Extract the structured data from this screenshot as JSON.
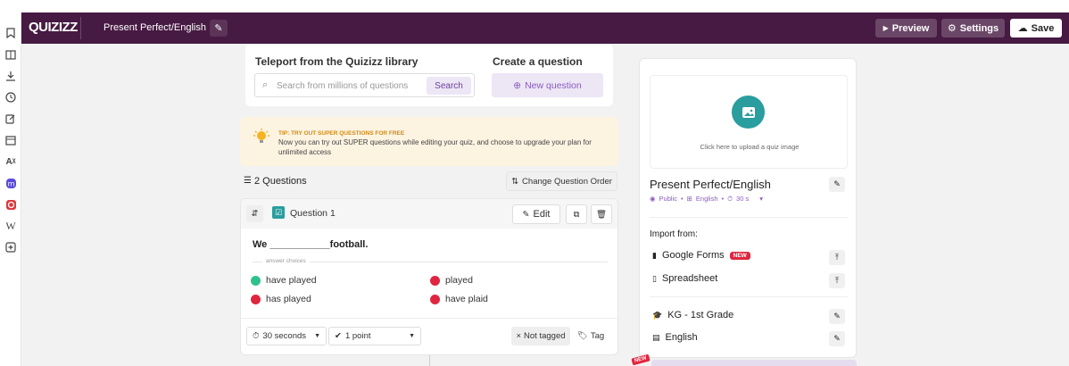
{
  "header": {
    "logo": "QUIZIZZ",
    "quiz_title": "Present Perfect/English",
    "preview_label": "Preview",
    "settings_label": "Settings",
    "save_label": "Save"
  },
  "sidebar": {
    "icons": [
      "bookmark-icon",
      "library-icon",
      "download-icon",
      "history-icon",
      "edit-icon",
      "calendar-icon",
      "translate-icon",
      "mastodon-icon",
      "vivaldi-icon",
      "wikipedia-icon",
      "add-box-icon"
    ]
  },
  "teleport": {
    "heading": "Teleport from the Quizizz library",
    "search_placeholder": "Search from millions of questions",
    "search_button": "Search"
  },
  "create": {
    "heading": "Create a question",
    "new_question_label": "New question"
  },
  "tip": {
    "title": "TIP: TRY OUT SUPER QUESTIONS FOR FREE",
    "body": "Now you can try out SUPER questions while editing your quiz, and choose to upgrade your plan for unlimited access"
  },
  "questions": {
    "count_label": "2 Questions",
    "change_order_label": "Change Question Order"
  },
  "question1": {
    "label": "Question 1",
    "edit_label": "Edit",
    "text": "We ___________football.",
    "answer_choices_label": "answer choices",
    "choices": [
      {
        "text": "have played",
        "correct": true
      },
      {
        "text": "played",
        "correct": false
      },
      {
        "text": "has played",
        "correct": false
      },
      {
        "text": "have plaid",
        "correct": false
      }
    ],
    "time_label": "30 seconds",
    "points_label": "1 point",
    "not_tagged_label": "Not tagged",
    "tag_label": "Tag"
  },
  "side": {
    "upload_hint": "Click here to upload a quiz image",
    "quiz_name": "Present Perfect/English",
    "meta_public": "Public",
    "meta_language": "English",
    "meta_time": "30 s",
    "import_heading": "Import from:",
    "google_forms": "Google Forms",
    "new_badge": "NEW",
    "spreadsheet": "Spreadsheet",
    "grade": "KG - 1st Grade",
    "subject": "English",
    "bottom_badge": "NEW"
  },
  "colors": {
    "header": "#461a42",
    "accent": "#8a5cc2",
    "correct": "#2ec28b",
    "incorrect": "#e0263f",
    "teal": "#2a9d9f"
  }
}
